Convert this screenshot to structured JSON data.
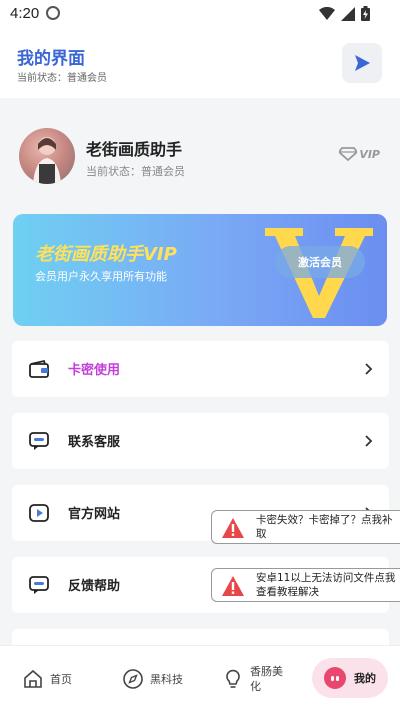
{
  "status_bar": {
    "time": "4:20"
  },
  "header": {
    "title": "我的界面",
    "subtitle": "当前状态：普通会员"
  },
  "profile": {
    "name": "老街画质助手",
    "status": "当前状态：普通会员",
    "vip_badge": "VIP"
  },
  "vip_card": {
    "title": "老街画质助手VIP",
    "subtitle": "会员用户永久享用所有功能",
    "button": "激活会员"
  },
  "menu": [
    {
      "label": "卡密使用",
      "icon": "card-icon"
    },
    {
      "label": "联系客服",
      "icon": "chat-icon"
    },
    {
      "label": "官方网站",
      "icon": "play-square-icon"
    },
    {
      "label": "反馈帮助",
      "icon": "chat-icon"
    }
  ],
  "toasts": [
    {
      "text": "卡密失效？卡密掉了？点我补取",
      "icon": "warning-icon"
    },
    {
      "text": "安卓11以上无法访问文件点我查看教程解决",
      "icon": "warning-icon"
    }
  ],
  "bottom_nav": [
    {
      "label": "首页",
      "icon": "home-icon"
    },
    {
      "label": "黑科技",
      "icon": "compass-icon"
    },
    {
      "label": "香肠美化",
      "icon": "bulb-icon"
    },
    {
      "label": "我的",
      "icon": "face-icon",
      "active": true
    }
  ],
  "colors": {
    "accent": "#3a66d6",
    "menu_accent": "#c23fd8",
    "nav_active_bg": "#fbe1ea",
    "warning": "#e8474a"
  }
}
